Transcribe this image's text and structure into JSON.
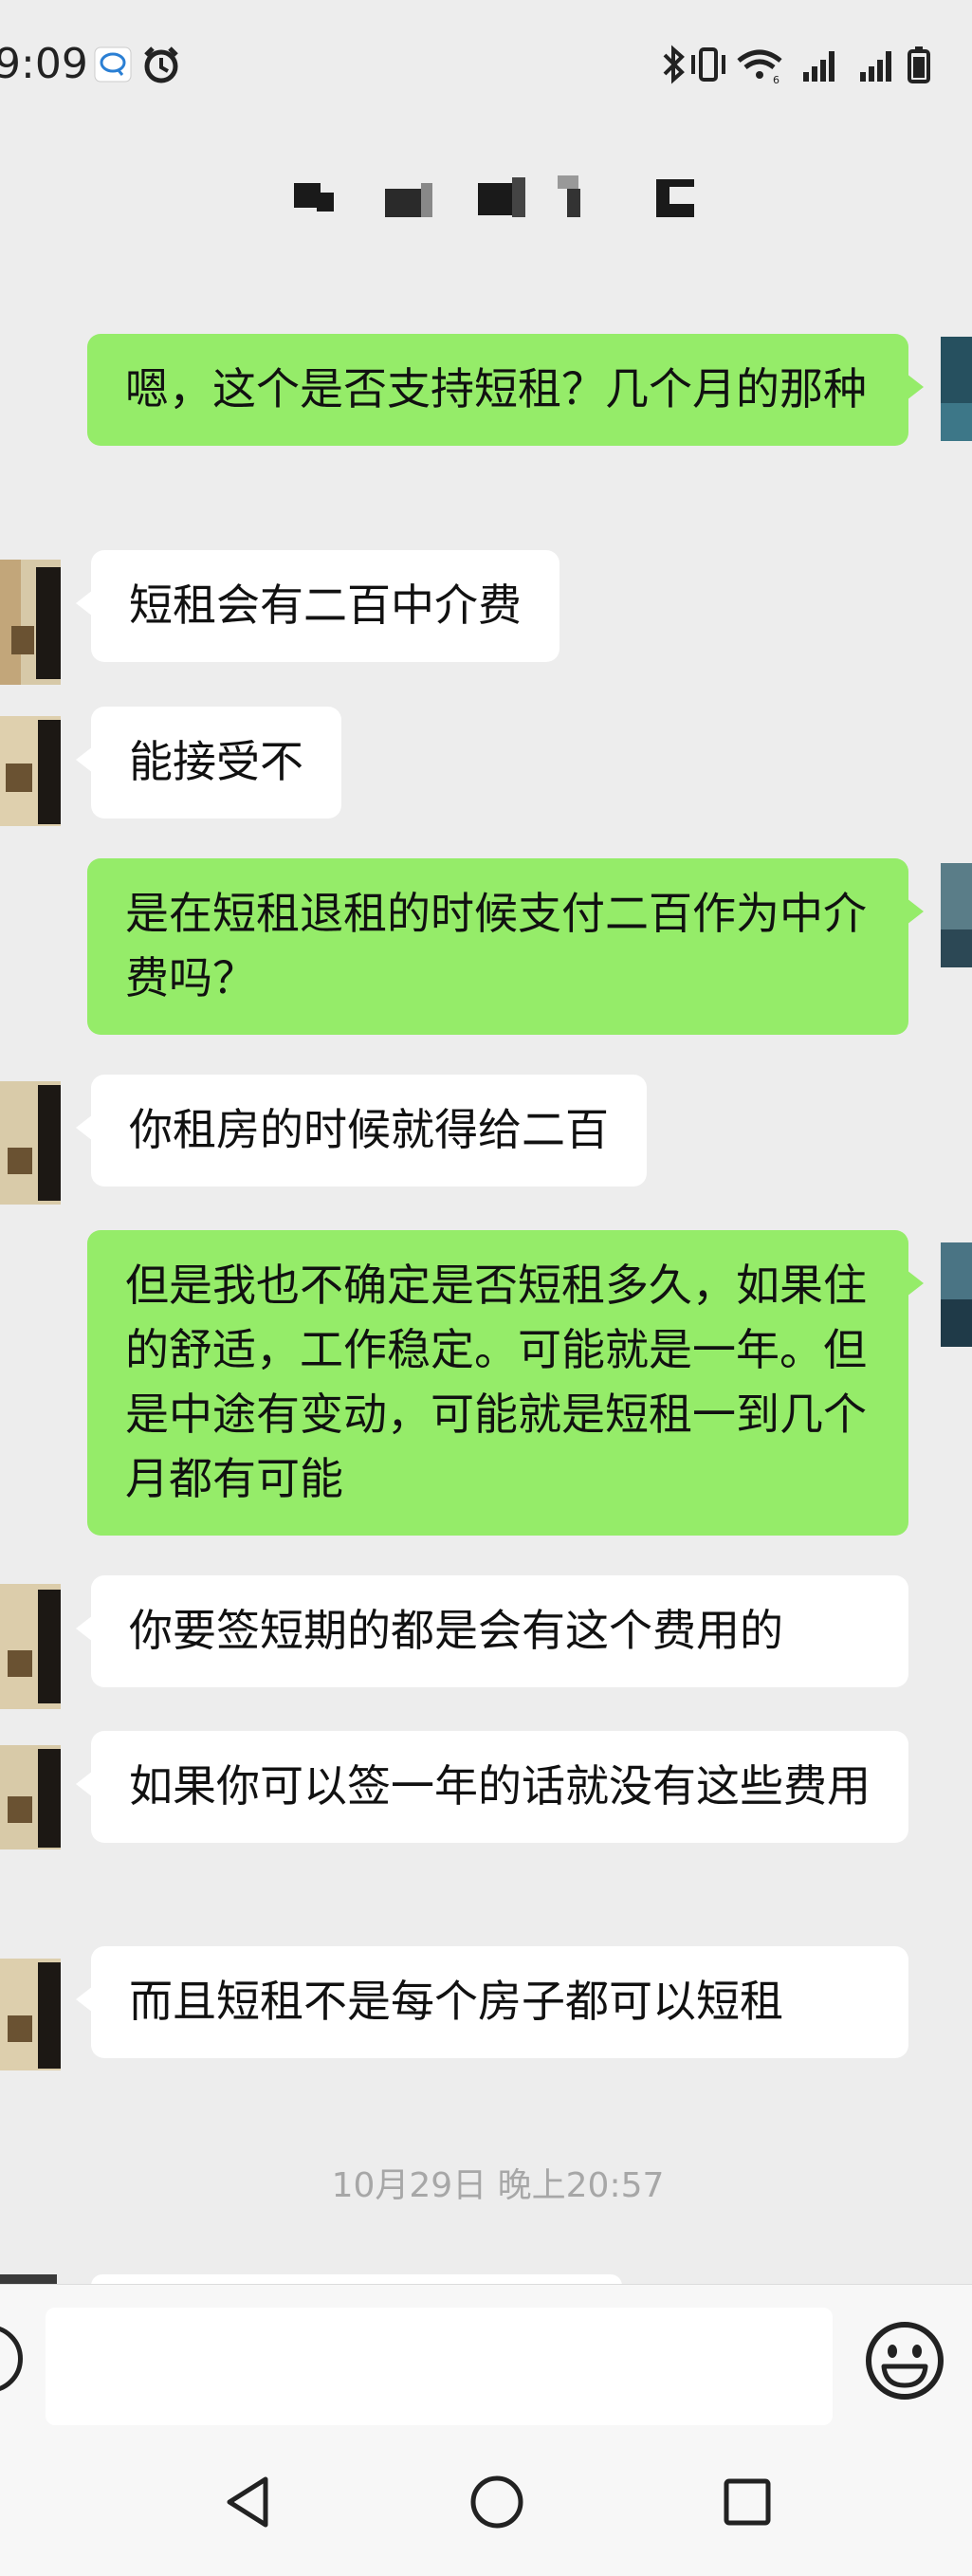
{
  "status_bar": {
    "time": "9:09",
    "left_icons": [
      "chat-notification-icon",
      "alarm-icon"
    ],
    "right_icons": [
      "bluetooth-icon",
      "vibrate-icon",
      "wifi-icon",
      "signal-icon",
      "signal-icon",
      "battery-icon"
    ]
  },
  "chat": {
    "title_blurred": true,
    "messages": [
      {
        "sender": "me",
        "text": "嗯，这个是否支持短租？几个月的那种"
      },
      {
        "sender": "them",
        "text": "短租会有二百中介费"
      },
      {
        "sender": "them",
        "text": "能接受不"
      },
      {
        "sender": "me",
        "text": "是在短租退租的时候支付二百作为中介费吗？"
      },
      {
        "sender": "them",
        "text": "你租房的时候就得给二百"
      },
      {
        "sender": "me",
        "text": "但是我也不确定是否短租多久，如果住的舒适，工作稳定。可能就是一年。但是中途有变动，可能就是短租一到几个月都有可能"
      },
      {
        "sender": "them",
        "text": "你要签短期的都是会有这个费用的"
      },
      {
        "sender": "them",
        "text": "如果你可以签一年的话就没有这些费用"
      },
      {
        "sender": "them",
        "text": "而且短租不是每个房子都可以短租"
      }
    ],
    "timestamp": "10月29日 晚上20:57"
  },
  "input": {
    "value": "",
    "voice_icon": "voice-icon",
    "emoji_icon": "emoji-icon"
  },
  "nav": {
    "icons": [
      "back-icon",
      "home-icon",
      "recents-icon"
    ]
  },
  "colors": {
    "background": "#ededed",
    "my_bubble": "#95ec69",
    "their_bubble": "#ffffff",
    "timestamp": "#a7a7a7"
  }
}
